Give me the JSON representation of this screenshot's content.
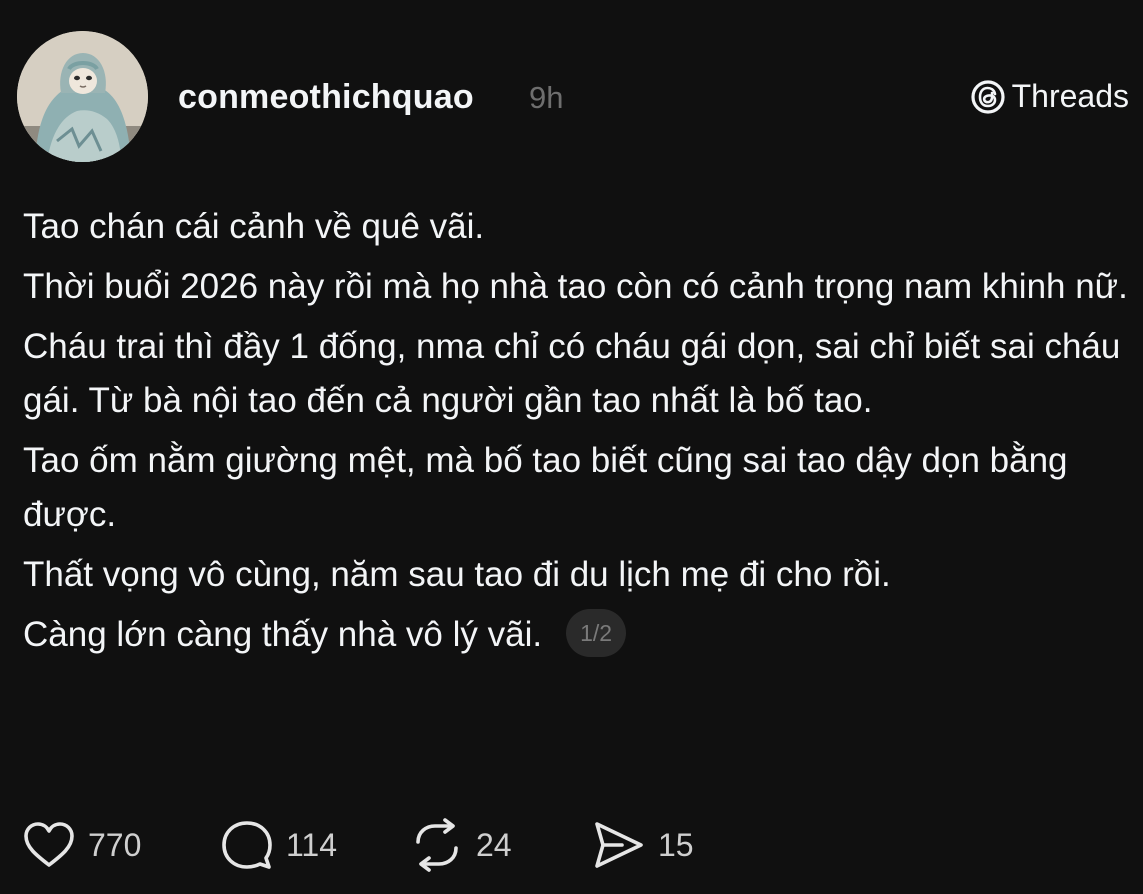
{
  "post": {
    "username": "conmeothichquao",
    "time": "9h",
    "brand": {
      "label": "Threads",
      "icon": "threads-logo-icon"
    },
    "paragraphs": [
      "Tao chán cái cảnh về quê vãi.",
      "Thời buổi 2026 này rồi mà họ nhà tao còn có cảnh trọng nam khinh nữ.",
      "Cháu trai thì đầy 1 đống, nma chỉ có cháu gái dọn, sai chỉ biết sai cháu gái. Từ bà nội tao đến cả người gần tao nhất là bố tao.",
      "Tao ốm nằm giường mệt, mà bố tao biết cũng sai tao dậy dọn bằng được.",
      "Thất vọng vô cùng, năm sau tao đi du lịch mẹ đi cho rồi.",
      "Càng lớn càng thấy nhà vô lý vãi."
    ],
    "pager": "1/2",
    "actions": {
      "likes": "770",
      "replies": "114",
      "reposts": "24",
      "shares": "15"
    }
  },
  "colors": {
    "background": "#101010",
    "text": "#f3f5f7",
    "muted": "#6e6e6e",
    "pill": "#2a2a2a"
  },
  "icons": [
    "heart-icon",
    "comment-icon",
    "repost-icon",
    "share-icon",
    "threads-logo-icon"
  ]
}
